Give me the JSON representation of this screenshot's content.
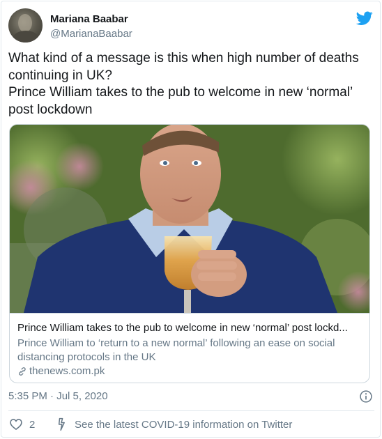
{
  "author": {
    "display_name": "Mariana Baabar",
    "handle": "@MarianaBaabar"
  },
  "tweet": {
    "lines": [
      "What kind of a message is this when high number of deaths",
      "continuing in UK?",
      "Prince William takes to the pub to welcome in new ‘normal’",
      "post lockdown"
    ]
  },
  "card": {
    "title": "Prince William takes to the pub to welcome in new ‘normal’ post lockd...",
    "description_lines": [
      "Prince William to ‘return to a new normal’ following an ease on social",
      "distancing protocols in the UK"
    ],
    "domain": "thenews.com.pk"
  },
  "meta": {
    "timestamp": "5:35 PM · Jul 5, 2020"
  },
  "actions": {
    "like_count": "2",
    "covid_link": "See the latest COVID-19 information on Twitter"
  },
  "colors": {
    "twitter_blue": "#1DA1F2",
    "secondary_text": "#657786",
    "border": "#ccd6dd"
  },
  "icons": [
    "twitter-bird-icon",
    "link-icon",
    "info-icon",
    "heart-icon",
    "lightning-bolt-icon"
  ]
}
